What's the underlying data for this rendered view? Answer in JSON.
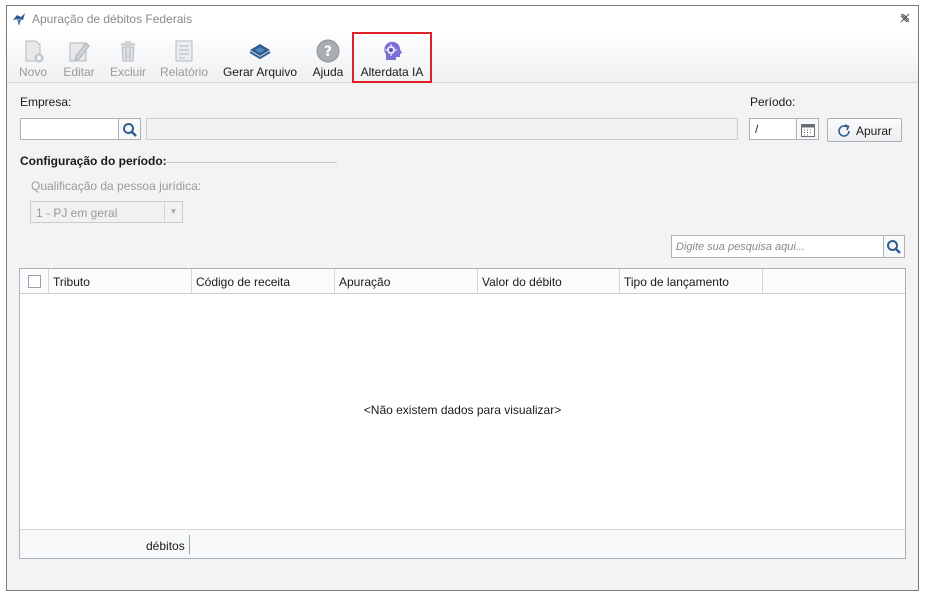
{
  "window": {
    "title": "Apuração de débitos Federais",
    "close_glyph": "×"
  },
  "toolbar": {
    "items": [
      {
        "label": "Novo",
        "icon": "new-document-icon",
        "enabled": false
      },
      {
        "label": "Editar",
        "icon": "edit-pencil-icon",
        "enabled": false
      },
      {
        "label": "Excluir",
        "icon": "trash-icon",
        "enabled": false
      },
      {
        "label": "Relatório",
        "icon": "report-icon",
        "enabled": false
      },
      {
        "label": "Gerar Arquivo",
        "icon": "generate-file-icon",
        "enabled": true
      },
      {
        "label": "Ajuda",
        "icon": "help-icon",
        "enabled": true
      },
      {
        "label": "Alterdata IA",
        "icon": "ai-head-icon",
        "enabled": true,
        "highlighted": true
      }
    ]
  },
  "form": {
    "empresa_label": "Empresa:",
    "empresa_value": "",
    "empresa_name": "",
    "periodo_label": "Período:",
    "periodo_value": "/",
    "apurar_label": "Apurar"
  },
  "config": {
    "title": "Configuração do período:",
    "qualificacao_label": "Qualificação da pessoa jurídica:",
    "qualificacao_value": "1 - PJ em geral"
  },
  "search": {
    "placeholder": "Digite sua pesquisa aqui..."
  },
  "grid": {
    "columns": [
      "Tributo",
      "Código de receita",
      "Apuração",
      "Valor do débito",
      "Tipo de lançamento"
    ],
    "empty_message": "<Não existem dados para visualizar>",
    "footer_label": "débitos"
  },
  "colors": {
    "highlight_border": "#e0202a",
    "disabled_text": "#9a9a9a"
  }
}
